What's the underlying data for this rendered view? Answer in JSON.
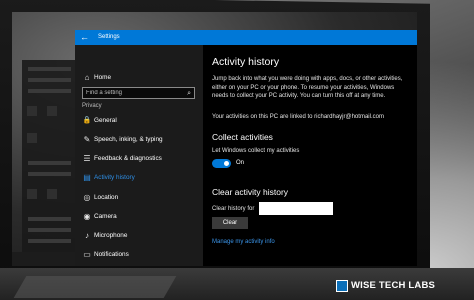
{
  "window": {
    "title": "Settings",
    "back_glyph": "←"
  },
  "sidebar": {
    "home": {
      "label": "Home",
      "icon": "home-icon",
      "glyph": "⌂"
    },
    "search": {
      "placeholder": "Find a setting",
      "icon": "search-icon",
      "glyph": "⌕"
    },
    "section": "Privacy",
    "items": [
      {
        "label": "General",
        "icon": "lock-icon",
        "glyph": "🔒",
        "active": false
      },
      {
        "label": "Speech, inking, & typing",
        "icon": "speech-icon",
        "glyph": "✎",
        "active": false
      },
      {
        "label": "Feedback & diagnostics",
        "icon": "feedback-icon",
        "glyph": "☰",
        "active": false
      },
      {
        "label": "Activity history",
        "icon": "activity-icon",
        "glyph": "▤",
        "active": true
      },
      {
        "label": "Location",
        "icon": "location-icon",
        "glyph": "◎",
        "active": false
      },
      {
        "label": "Camera",
        "icon": "camera-icon",
        "glyph": "◉",
        "active": false
      },
      {
        "label": "Microphone",
        "icon": "microphone-icon",
        "glyph": "♪",
        "active": false
      },
      {
        "label": "Notifications",
        "icon": "notifications-icon",
        "glyph": "▭",
        "active": false
      }
    ]
  },
  "main": {
    "title": "Activity history",
    "description": "Jump back into what you were doing with apps, docs, or other activities, either on your PC or your phone. To resume your activities, Windows needs to collect your PC activity. You can turn this off at any time.",
    "linked_text": "Your activities on this PC are linked to richardhayjr@hotmail.com",
    "collect": {
      "heading": "Collect activities",
      "label": "Let Windows collect my activities",
      "toggle_state": "On",
      "toggle_on": true
    },
    "clear": {
      "heading": "Clear activity history",
      "label": "Clear history for",
      "input_value": "",
      "button": "Clear"
    },
    "link": "Manage my activity info"
  },
  "watermark": {
    "text": "WISE TECH LABS"
  },
  "colors": {
    "accent": "#0078d7",
    "link": "#3b95ea",
    "window_bg": "#000000",
    "sidebar_bg": "#1b1b1b"
  }
}
